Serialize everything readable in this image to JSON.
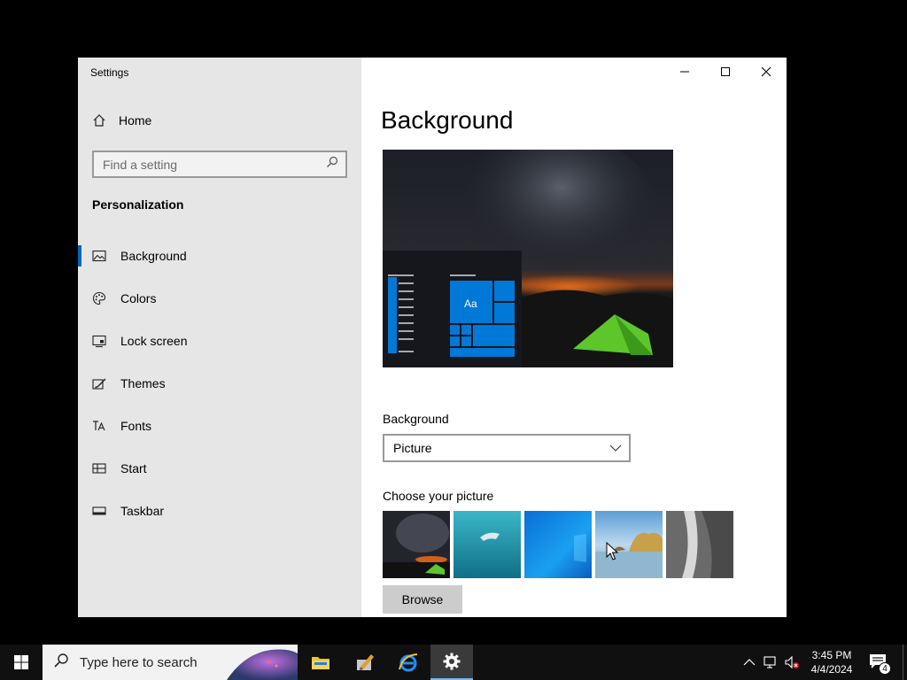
{
  "window": {
    "title": "Settings"
  },
  "sidebar": {
    "home_label": "Home",
    "search_placeholder": "Find a setting",
    "section_title": "Personalization",
    "items": [
      {
        "label": "Background",
        "icon": "picture-icon",
        "active": true
      },
      {
        "label": "Colors",
        "icon": "palette-icon"
      },
      {
        "label": "Lock screen",
        "icon": "lock-screen-icon"
      },
      {
        "label": "Themes",
        "icon": "themes-icon"
      },
      {
        "label": "Fonts",
        "icon": "fonts-icon"
      },
      {
        "label": "Start",
        "icon": "start-icon"
      },
      {
        "label": "Taskbar",
        "icon": "taskbar-icon"
      }
    ]
  },
  "main": {
    "title": "Background",
    "preview_tile_text": "Aa",
    "background_label": "Background",
    "background_value": "Picture",
    "choose_label": "Choose your picture",
    "thumbnails": [
      "night-tent",
      "underwater-swimmer",
      "windows-blue",
      "coastal-rocks",
      "waterfall-cliff"
    ],
    "browse_label": "Browse"
  },
  "taskbar": {
    "search_placeholder": "Type here to search",
    "apps": [
      "file-explorer-icon",
      "pen-app-icon",
      "internet-explorer-icon",
      "settings-gear-icon"
    ],
    "time": "3:45 PM",
    "date": "4/4/2024",
    "notification_count": "4"
  },
  "colors": {
    "accent": "#0067c0",
    "tile_blue": "#0078d7",
    "sidebar_bg": "#e6e6e6",
    "taskbar_bg": "#101010"
  }
}
